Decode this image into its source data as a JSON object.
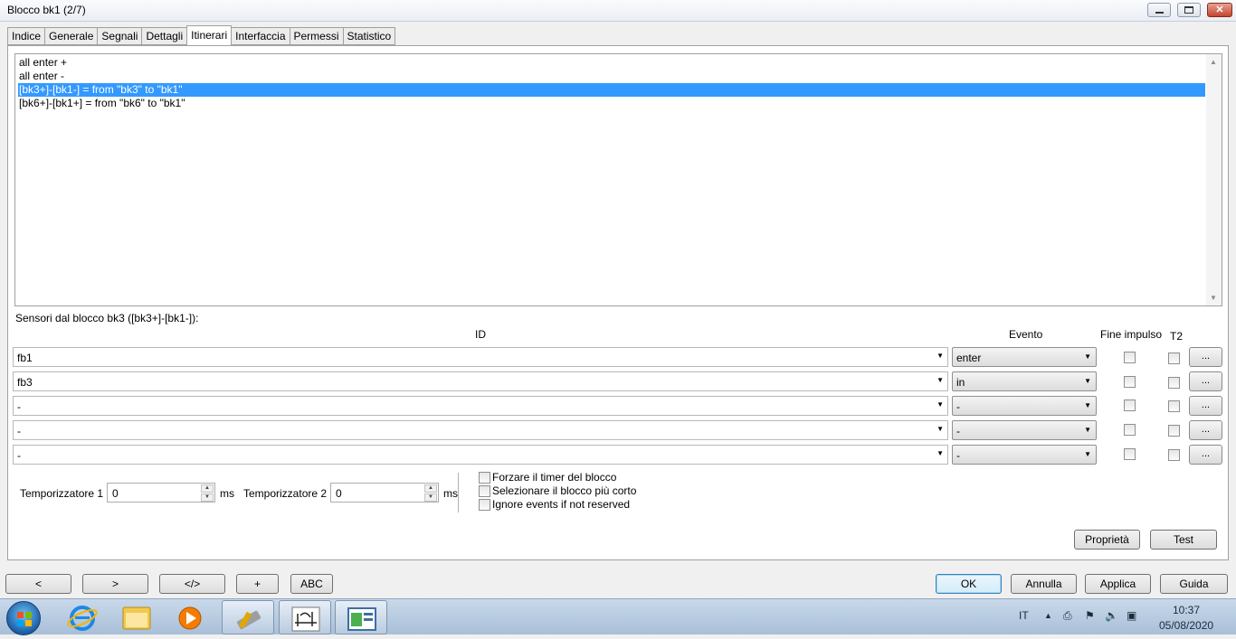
{
  "window": {
    "title": "Blocco bk1 (2/7)"
  },
  "tabs": [
    "Indice",
    "Generale",
    "Segnali",
    "Dettagli",
    "Itinerari",
    "Interfaccia",
    "Permessi",
    "Statistico"
  ],
  "active_tab": "Itinerari",
  "routes": [
    "all enter +",
    "all enter -",
    "[bk3+]-[bk1-] = from \"bk3\" to \"bk1\"",
    "[bk6+]-[bk1+] = from \"bk6\" to \"bk1\""
  ],
  "selected_route_index": 2,
  "sensors": {
    "title": "Sensori dal blocco bk3 ([bk3+]-[bk1-]):",
    "headers": {
      "id": "ID",
      "event": "Evento",
      "end_pulse": "Fine impulso",
      "t2": "T2"
    },
    "rows": [
      {
        "id": "fb1",
        "event": "enter",
        "end_pulse": false,
        "t2": false,
        "more": "..."
      },
      {
        "id": "fb3",
        "event": "in",
        "end_pulse": false,
        "t2": false,
        "more": "..."
      },
      {
        "id": "-",
        "event": "-",
        "end_pulse": false,
        "t2": false,
        "more": "..."
      },
      {
        "id": "-",
        "event": "-",
        "end_pulse": false,
        "t2": false,
        "more": "..."
      },
      {
        "id": "-",
        "event": "-",
        "end_pulse": false,
        "t2": false,
        "more": "..."
      }
    ]
  },
  "timers": {
    "t1_label": "Temporizzatore 1",
    "t1_value": "0",
    "t1_unit": "ms",
    "t2_label": "Temporizzatore 2",
    "t2_value": "0",
    "t2_unit": "ms"
  },
  "options": [
    {
      "label": "Forzare il timer del blocco",
      "checked": false
    },
    {
      "label": "Selezionare il blocco più corto",
      "checked": false
    },
    {
      "label": "Ignore events if not reserved",
      "checked": false
    }
  ],
  "panel_buttons": {
    "properties": "Proprietà",
    "test": "Test"
  },
  "nav_buttons": [
    "<",
    ">",
    "</>",
    "+",
    "ABC"
  ],
  "dialog_buttons": {
    "ok": "OK",
    "cancel": "Annulla",
    "apply": "Applica",
    "help": "Guida"
  },
  "taskbar": {
    "language": "IT",
    "time": "10:37",
    "date": "05/08/2020"
  }
}
